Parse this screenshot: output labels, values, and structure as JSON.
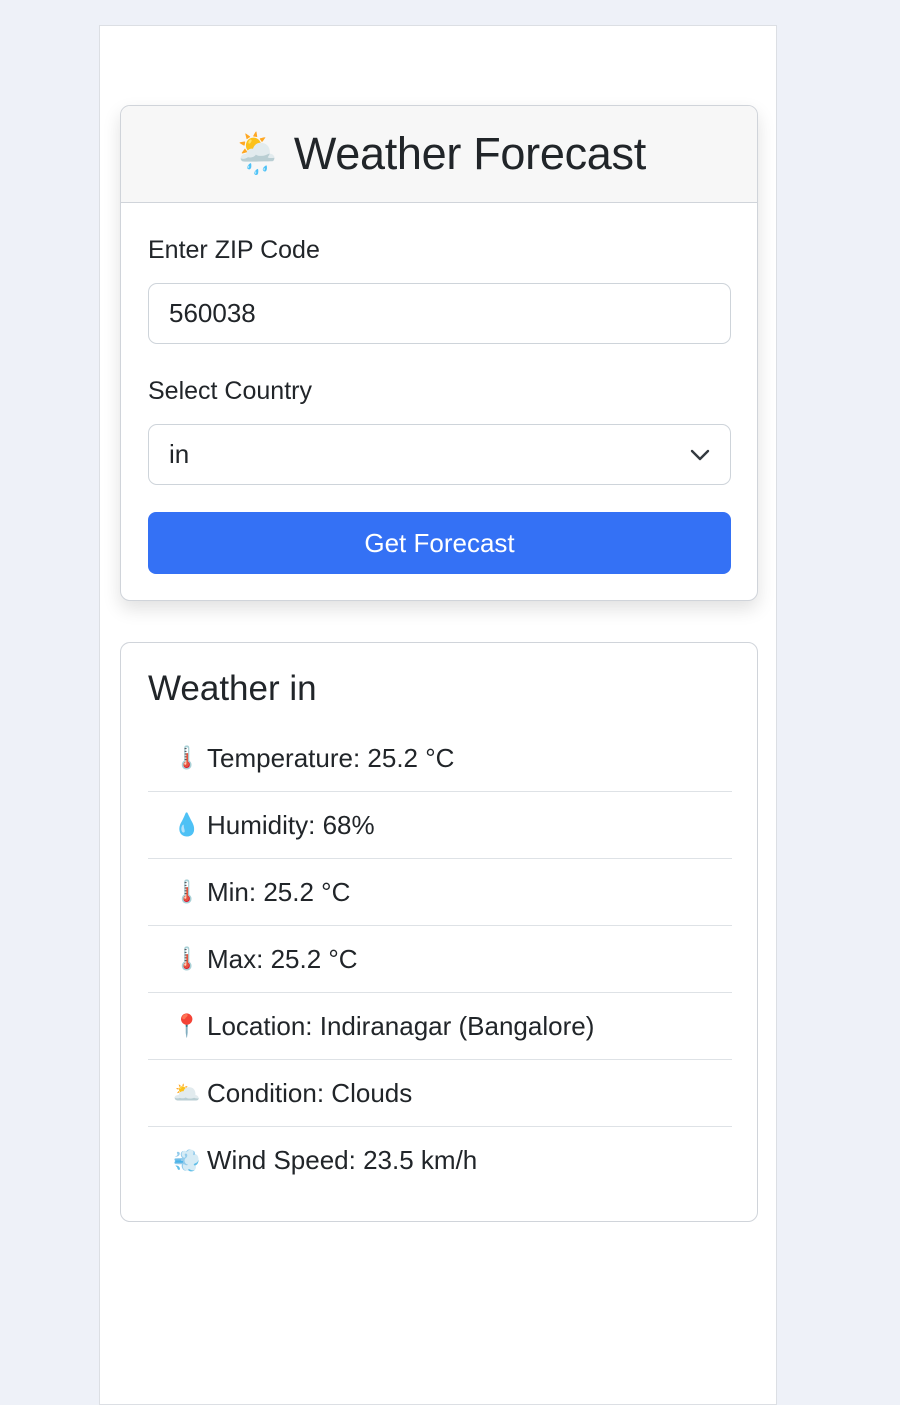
{
  "form": {
    "title_icon": "🌦️",
    "title": "Weather Forecast",
    "zip_label": "Enter ZIP Code",
    "zip_value": "560038",
    "country_label": "Select Country",
    "country_value": "in",
    "submit_label": "Get Forecast"
  },
  "result": {
    "title": "Weather in",
    "items": [
      {
        "icon": "🌡️",
        "icon_name": "thermometer-icon",
        "text": "Temperature: 25.2 °C"
      },
      {
        "icon": "💧",
        "icon_name": "droplet-icon",
        "text": "Humidity: 68%"
      },
      {
        "icon": "🌡️",
        "icon_name": "thermometer-icon",
        "text": "Min: 25.2 °C"
      },
      {
        "icon": "🌡️",
        "icon_name": "thermometer-icon",
        "text": "Max: 25.2 °C"
      },
      {
        "icon": "📍",
        "icon_name": "pin-icon",
        "text": "Location: Indiranagar (Bangalore)"
      },
      {
        "icon": "🌥️",
        "icon_name": "sun-cloud-icon",
        "text": "Condition: Clouds"
      },
      {
        "icon": "💨",
        "icon_name": "wind-icon",
        "text": "Wind Speed: 23.5 km/h"
      }
    ]
  },
  "colors": {
    "background": "#eef1f8",
    "primary": "#3471f5",
    "border": "#d0d4da"
  }
}
